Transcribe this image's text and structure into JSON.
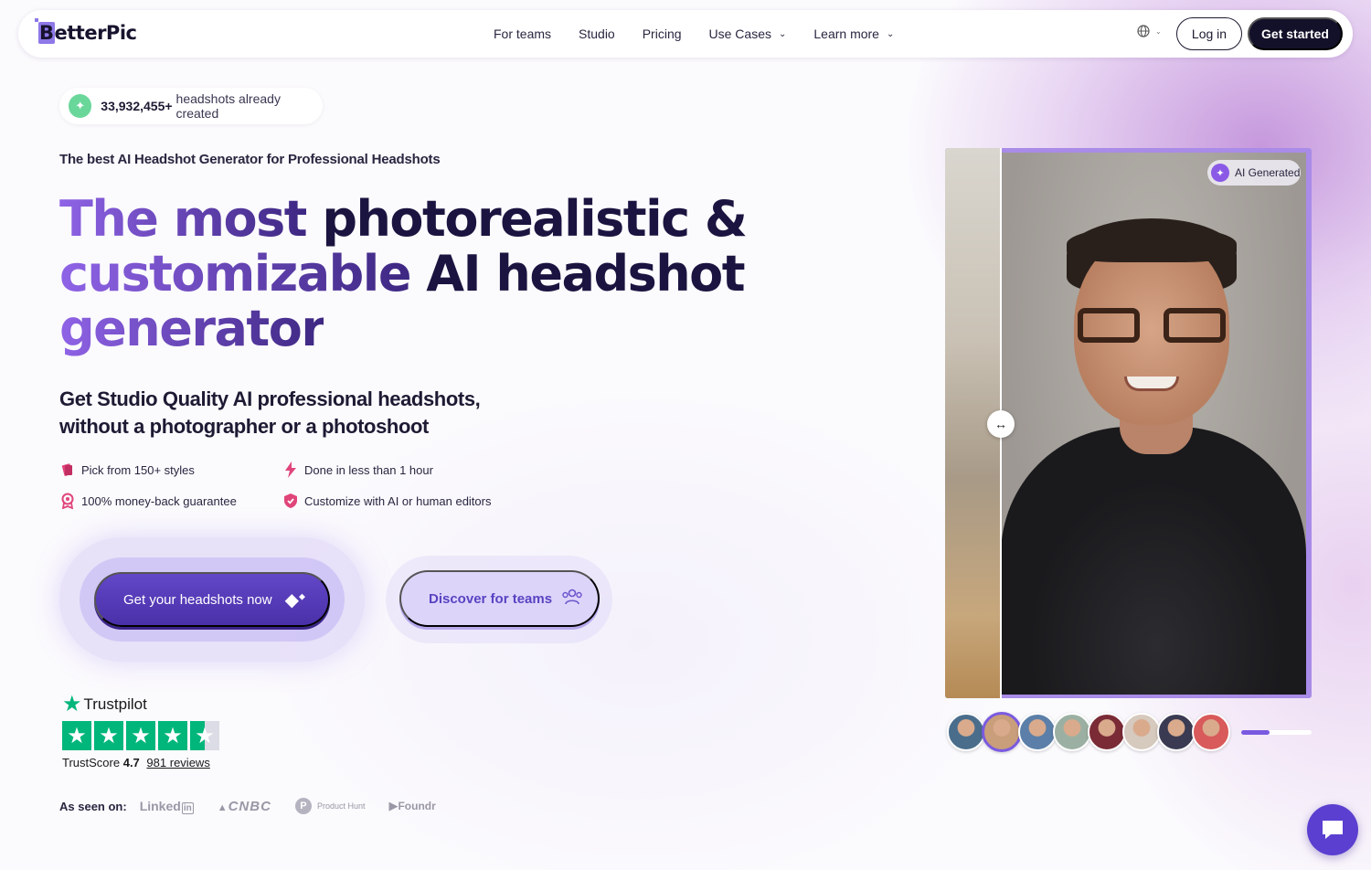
{
  "nav": {
    "logo": "BetterPic",
    "links": [
      "For teams",
      "Studio",
      "Pricing"
    ],
    "dropdowns": [
      "Use Cases",
      "Learn more"
    ],
    "login": "Log in",
    "get_started": "Get started"
  },
  "counter": {
    "number": "33,932,455+",
    "text": "headshots already created"
  },
  "eyebrow": "The best AI Headshot Generator for Professional Headshots",
  "headline": {
    "line1_grad": "The most",
    "line1_rest": " photorealistic &",
    "line2_grad": "customizable",
    "line2_rest": " AI headshot",
    "line3_grad": "generator"
  },
  "subheadline": {
    "line1": "Get Studio Quality AI professional headshots,",
    "line2": "without a photographer or a photoshoot"
  },
  "features": [
    "Pick from 150+ styles",
    "Done in less than 1 hour",
    "100% money-back guarantee",
    "Customize with AI or human editors"
  ],
  "cta": {
    "primary": "Get your headshots now",
    "secondary": "Discover for teams"
  },
  "trustpilot": {
    "brand": "Trustpilot",
    "label": "TrustScore",
    "score": "4.7",
    "reviews_count": "981",
    "reviews_label": "reviews",
    "rating": 4.5
  },
  "as_seen_on": {
    "label": "As seen on:",
    "brands": [
      "Linked",
      "CNBC",
      "Product Hunt",
      "Foundr"
    ]
  },
  "photo": {
    "badge": "AI Generated",
    "thumb_colors": [
      "#4a6d8c",
      "#c99e7b",
      "#5b7fa8",
      "#9bb0a2",
      "#7a2b35",
      "#d6c9bd",
      "#3a3a52",
      "#d85a5a"
    ],
    "active_thumb": 1,
    "progress": 0.4
  },
  "colors": {
    "brand_purple": "#5a3fd0",
    "trustpilot_green": "#00b67a",
    "dark": "#13112a"
  }
}
